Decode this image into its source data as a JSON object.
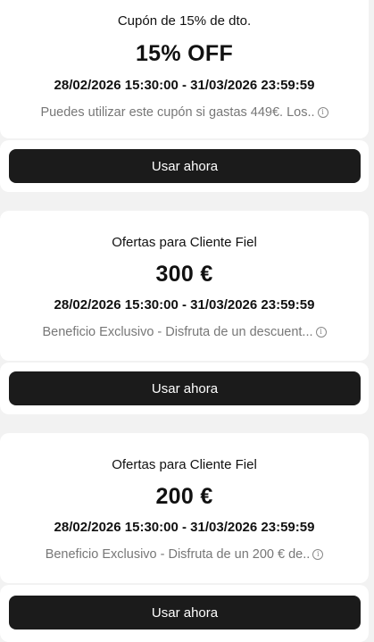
{
  "coupons": [
    {
      "subtitle": "Cupón de 15% de dto.",
      "value": "15% OFF",
      "validity": "28/02/2026 15:30:00 - 31/03/2026 23:59:59",
      "description": "Puedes utilizar este cupón si gastas 449€. Los..",
      "button_label": "Usar ahora"
    },
    {
      "subtitle": "Ofertas para Cliente Fiel",
      "value": "300  €",
      "validity": "28/02/2026 15:30:00 - 31/03/2026 23:59:59",
      "description": "Beneficio Exclusivo - Disfruta de un descuent...",
      "button_label": "Usar ahora"
    },
    {
      "subtitle": "Ofertas para Cliente Fiel",
      "value": "200  €",
      "validity": "28/02/2026 15:30:00 - 31/03/2026 23:59:59",
      "description": "Beneficio Exclusivo - Disfruta de un 200 € de..",
      "button_label": "Usar ahora"
    }
  ],
  "info_icon_glyph": "i"
}
